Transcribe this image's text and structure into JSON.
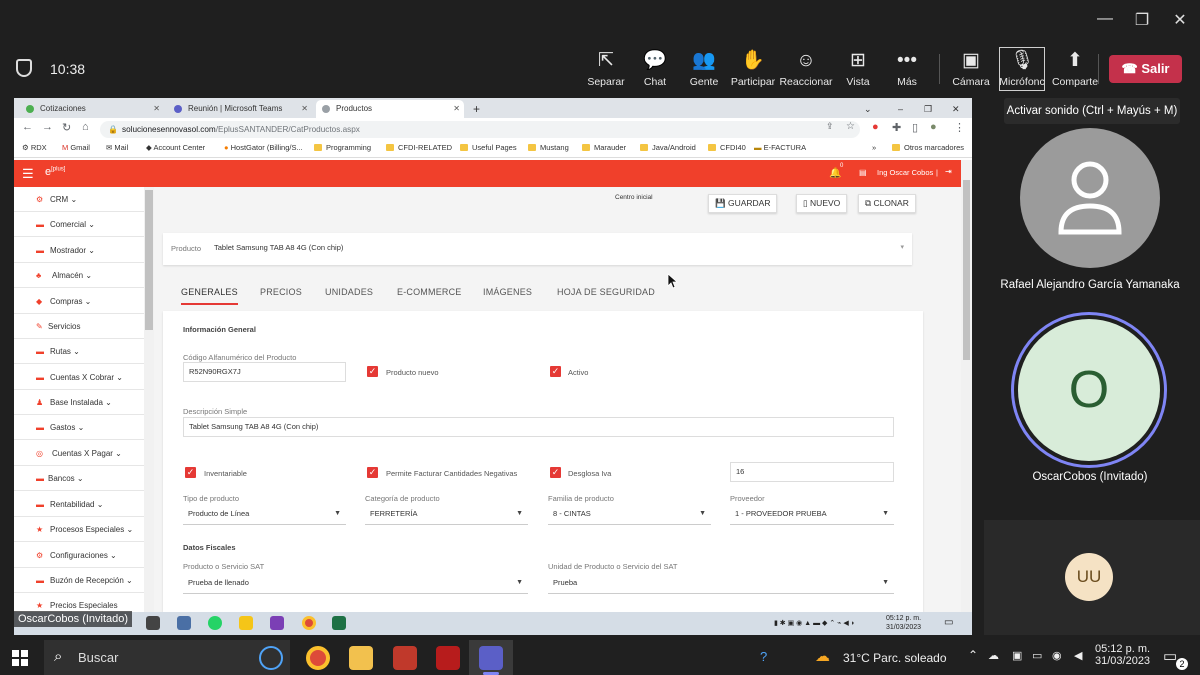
{
  "teams": {
    "time": "10:38",
    "buttons": {
      "separar": "Separar",
      "chat": "Chat",
      "gente": "Gente",
      "participar": "Participar",
      "reaccionar": "Reaccionar",
      "vista": "Vista",
      "mas": "Más",
      "camara": "Cámara",
      "microfono": "Micrófonc",
      "comparte": "Comparte",
      "salir": "Salir"
    },
    "tooltip": "Activar sonido (Ctrl + Mayús + M)",
    "participants": [
      {
        "name": "Rafael Alejandro García Yamanaka",
        "initials": ""
      },
      {
        "name": "OscarCobos (Invitado)",
        "initials": "O"
      },
      {
        "name": "",
        "initials": "UU"
      }
    ],
    "presenter_label": "OscarCobos (Invitado)"
  },
  "browser": {
    "tabs": [
      {
        "title": "Cotizaciones"
      },
      {
        "title": "Reunión | Microsoft Teams"
      },
      {
        "title": "Productos"
      }
    ],
    "url_host": "solucionesennovasol.com",
    "url_path": "/EplusSANTANDER/CatProductos.aspx",
    "bookmarks": [
      "RDX",
      "Gmail",
      "Mail",
      "Account Center",
      "HostGator (Billing/S...",
      "Programming",
      "CFDI-RELATED",
      "Useful Pages",
      "Mustang",
      "Marauder",
      "Java/Android",
      "CFDI40",
      "E-FACTURA"
    ],
    "other_bookmarks": "Otros marcadores"
  },
  "app": {
    "logo": "e",
    "logo_sup": "[plus]",
    "notif_count": "0",
    "user": "Ing Oscar Cobos",
    "sidebar": [
      "CRM",
      "Comercial",
      "Mostrador",
      "Almacén",
      "Compras",
      "Servicios",
      "Rutas",
      "Cuentas X Cobrar",
      "Base Instalada",
      "Gastos",
      "Cuentas X Pagar",
      "Bancos",
      "Rentabilidad",
      "Procesos Especiales",
      "Configuraciones",
      "Buzón de Recepción",
      "Precios Especiales"
    ],
    "centro": "Centro inicial",
    "btn_guardar": "GUARDAR",
    "btn_nuevo": "NUEVO",
    "btn_clonar": "CLONAR",
    "producto_label": "Producto",
    "producto_value": "Tablet Samsung TAB A8 4G  (Con chip)",
    "tabs": [
      "GENERALES",
      "PRECIOS",
      "UNIDADES",
      "E-COMMERCE",
      "IMÁGENES",
      "HOJA DE SEGURIDAD"
    ],
    "info_general": "Información General",
    "codigo_label": "Código Alfanumérico del Producto",
    "codigo_value": "R52N90RGX7J",
    "producto_nuevo": "Producto nuevo",
    "activo": "Activo",
    "desc_label": "Descripción Simple",
    "desc_value": "Tablet Samsung TAB A8 4G  (Con chip)",
    "inventariable": "Inventariable",
    "permite": "Permite Facturar Cantidades Negativas",
    "desglosa": "Desglosa Iva",
    "iva_value": "16",
    "tipo_label": "Tipo de producto",
    "tipo_value": "Producto de Línea",
    "categoria_label": "Categoría de producto",
    "categoria_value": "FERRETERÍA",
    "familia_label": "Familia de producto",
    "familia_value": "8 - CINTAS",
    "proveedor_label": "Proveedor",
    "proveedor_value": "1 - PROVEEDOR PRUEBA",
    "datos_fiscales": "Datos Fiscales",
    "sat_label": "Producto o Servicio SAT",
    "sat_value": "Prueba de llenado",
    "unidad_label": "Unidad de Producto o Servicio del SAT",
    "unidad_value": "Prueba"
  },
  "remote_taskbar": {
    "time": "05:12 p. m.",
    "date": "31/03/2023"
  },
  "taskbar": {
    "search": "Buscar",
    "weather": "31°C  Parc. soleado",
    "time": "05:12 p. m.",
    "date": "31/03/2023",
    "notif": "2"
  }
}
